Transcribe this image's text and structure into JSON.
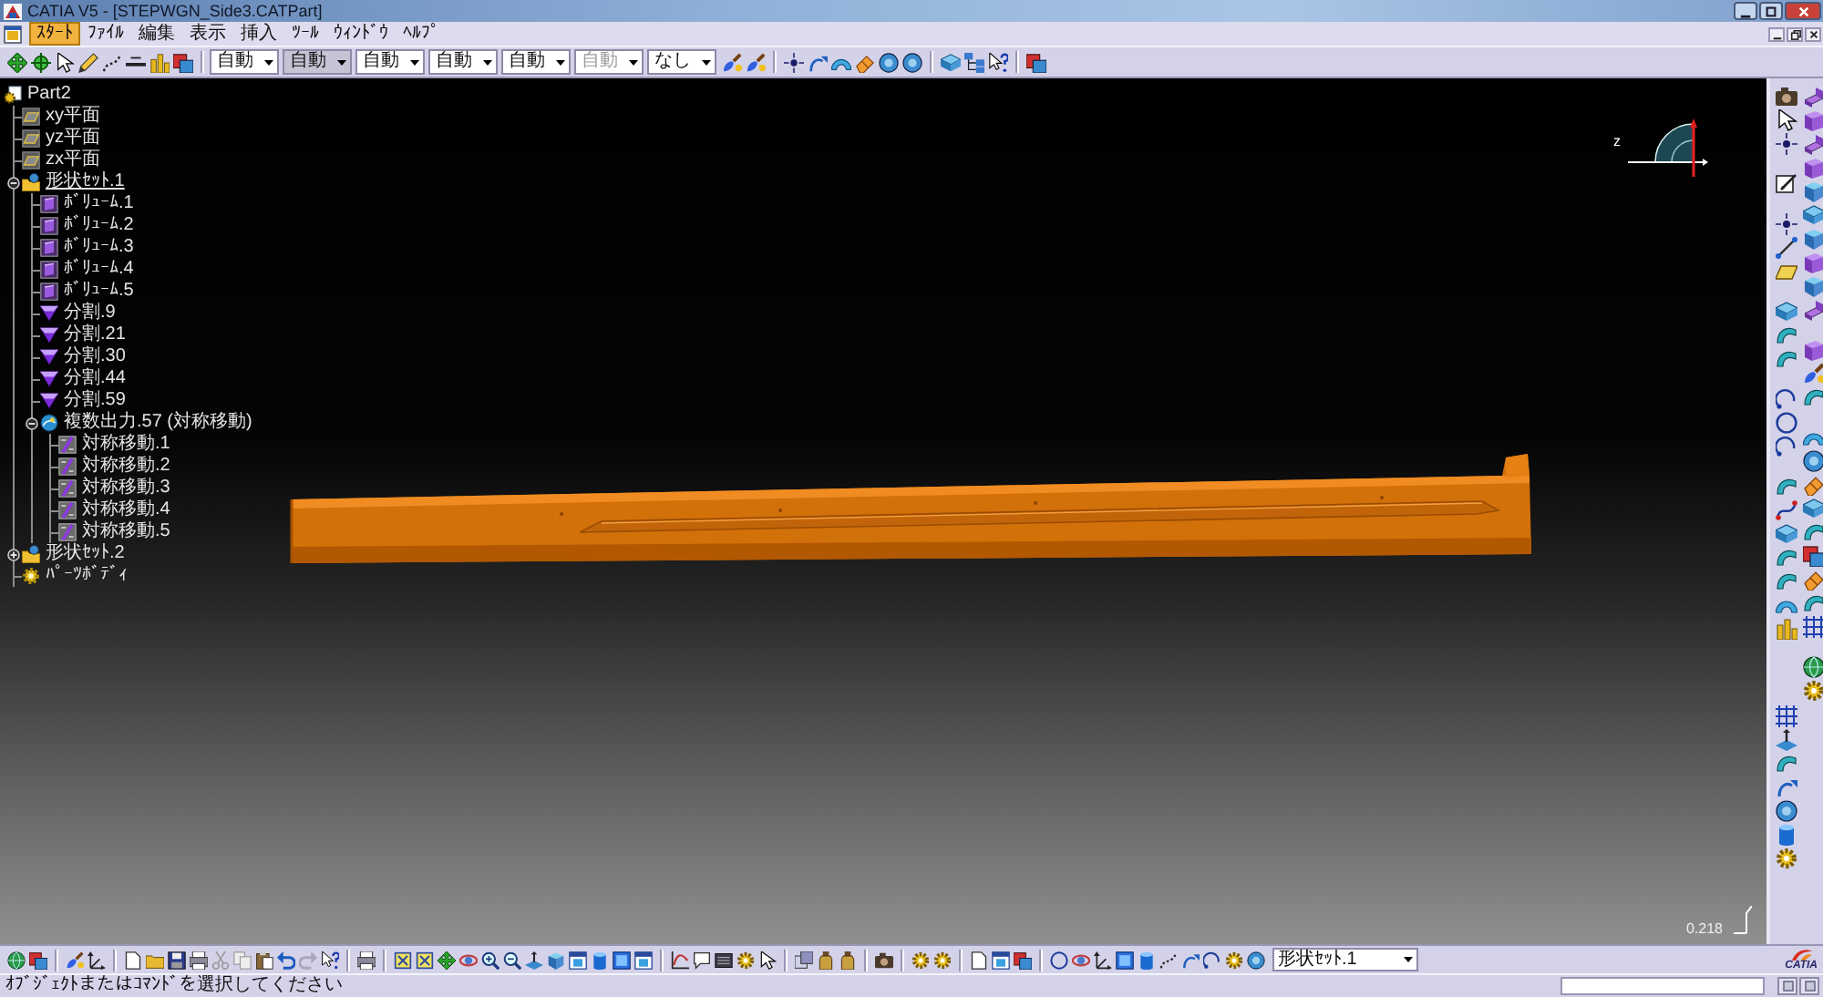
{
  "window": {
    "title": "CATIA V5 - [STEPWGN_Side3.CATPart]"
  },
  "menu": [
    {
      "label": "ｽﾀｰﾄ",
      "selected": true
    },
    {
      "label": "ﾌｧｲﾙ",
      "selected": false
    },
    {
      "label": "編集",
      "selected": false
    },
    {
      "label": "表示",
      "selected": false
    },
    {
      "label": "挿入",
      "selected": false
    },
    {
      "label": "ﾂｰﾙ",
      "selected": false
    },
    {
      "label": "ｳｨﾝﾄﾞｳ",
      "selected": false
    },
    {
      "label": "ﾍﾙﾌﾟ",
      "selected": false
    }
  ],
  "graphic_properties": [
    {
      "value": "自動",
      "focused": false,
      "disabled": false
    },
    {
      "value": "自動",
      "focused": true,
      "disabled": false
    },
    {
      "value": "自動",
      "focused": false,
      "disabled": false
    },
    {
      "value": "自動",
      "focused": false,
      "disabled": false
    },
    {
      "value": "自動",
      "focused": false,
      "disabled": false
    },
    {
      "value": "自動",
      "focused": false,
      "disabled": true
    },
    {
      "value": "なし",
      "focused": false,
      "disabled": false
    }
  ],
  "tree": [
    {
      "label": "Part2",
      "kind": "part",
      "in_work": false,
      "children": [
        {
          "label": "xy平面",
          "kind": "plane",
          "in_work": false
        },
        {
          "label": "yz平面",
          "kind": "plane",
          "in_work": false
        },
        {
          "label": "zx平面",
          "kind": "plane",
          "in_work": false
        },
        {
          "label": "形状ｾｯﾄ.1",
          "kind": "geoset",
          "in_work": true,
          "expanded": true,
          "children": [
            {
              "label": "ﾎﾞﾘｭｰﾑ.1",
              "kind": "volume",
              "in_work": false
            },
            {
              "label": "ﾎﾞﾘｭｰﾑ.2",
              "kind": "volume",
              "in_work": false
            },
            {
              "label": "ﾎﾞﾘｭｰﾑ.3",
              "kind": "volume",
              "in_work": false
            },
            {
              "label": "ﾎﾞﾘｭｰﾑ.4",
              "kind": "volume",
              "in_work": false
            },
            {
              "label": "ﾎﾞﾘｭｰﾑ.5",
              "kind": "volume",
              "in_work": false
            },
            {
              "label": "分割.9",
              "kind": "split",
              "in_work": false
            },
            {
              "label": "分割.21",
              "kind": "split",
              "in_work": false
            },
            {
              "label": "分割.30",
              "kind": "split",
              "in_work": false
            },
            {
              "label": "分割.44",
              "kind": "split",
              "in_work": false
            },
            {
              "label": "分割.59",
              "kind": "split",
              "in_work": false
            },
            {
              "label": "複数出力.57 (対称移動)",
              "kind": "multi_output",
              "in_work": false,
              "expanded": true,
              "children": [
                {
                  "label": "対称移動.1",
                  "kind": "symmetry",
                  "in_work": false
                },
                {
                  "label": "対称移動.2",
                  "kind": "symmetry",
                  "in_work": false
                },
                {
                  "label": "対称移動.3",
                  "kind": "symmetry",
                  "in_work": false
                },
                {
                  "label": "対称移動.4",
                  "kind": "symmetry",
                  "in_work": false
                },
                {
                  "label": "対称移動.5",
                  "kind": "symmetry",
                  "in_work": false
                }
              ]
            }
          ]
        },
        {
          "label": "形状ｾｯﾄ.2",
          "kind": "geoset",
          "in_work": false,
          "expanded": false
        },
        {
          "label": "ﾊﾟｰﾂﾎﾞﾃﾞｨ",
          "kind": "body",
          "in_work": false
        }
      ]
    }
  ],
  "compass": {
    "axis_label": "z"
  },
  "viewport": {
    "scale_reading": "0.218"
  },
  "work_object": {
    "value": "形状ｾｯﾄ.1"
  },
  "logo": {
    "text": "CATIA"
  },
  "status_bar": {
    "message": "ｵﾌﾞｼﾞｪｸﾄまたはｺﾏﾝﾄﾞを選択してください"
  }
}
